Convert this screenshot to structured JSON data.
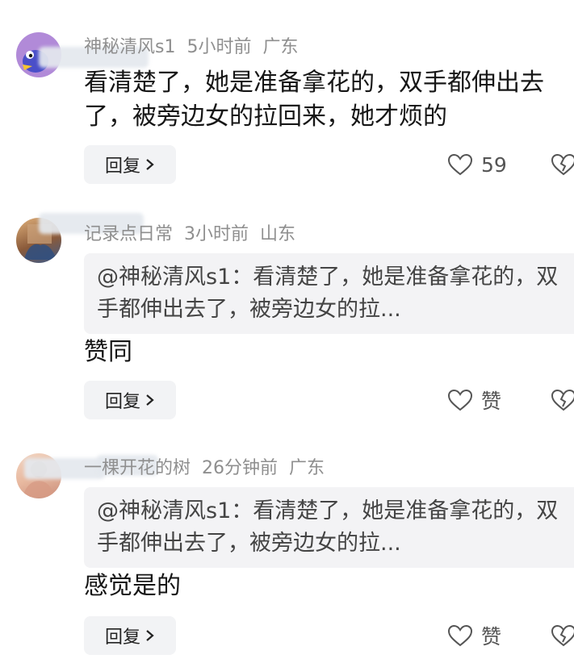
{
  "comments": [
    {
      "username": "神秘清风s1",
      "time": "5小时前",
      "location": "广东",
      "quote": null,
      "text": "看清楚了，她是准备拿花的，双手都伸出去了，被旁边女的拉回来，她才烦的",
      "reply_label": "回复",
      "like_label": "59",
      "avatar_icon": "cartoon-bird-avatar"
    },
    {
      "username": "记录点日常",
      "time": "3小时前",
      "location": "山东",
      "quote": "@神秘清风s1：看清楚了，她是准备拿花的，双手都伸出去了，被旁边女的拉...",
      "text": "赞同",
      "reply_label": "回复",
      "like_label": "赞",
      "avatar_icon": "photo-avatar"
    },
    {
      "username": "一棵开花的树",
      "time": "26分钟前",
      "location": "广东",
      "quote": "@神秘清风s1：看清楚了，她是准备拿花的，双手都伸出去了，被旁边女的拉...",
      "text": "感觉是的",
      "reply_label": "回复",
      "like_label": "赞",
      "avatar_icon": "photo-avatar"
    }
  ],
  "colors": {
    "meta_text": "#8f8f8f",
    "body_text": "#161616",
    "quote_bg": "#f3f3f5",
    "button_bg": "#f2f3f5"
  }
}
